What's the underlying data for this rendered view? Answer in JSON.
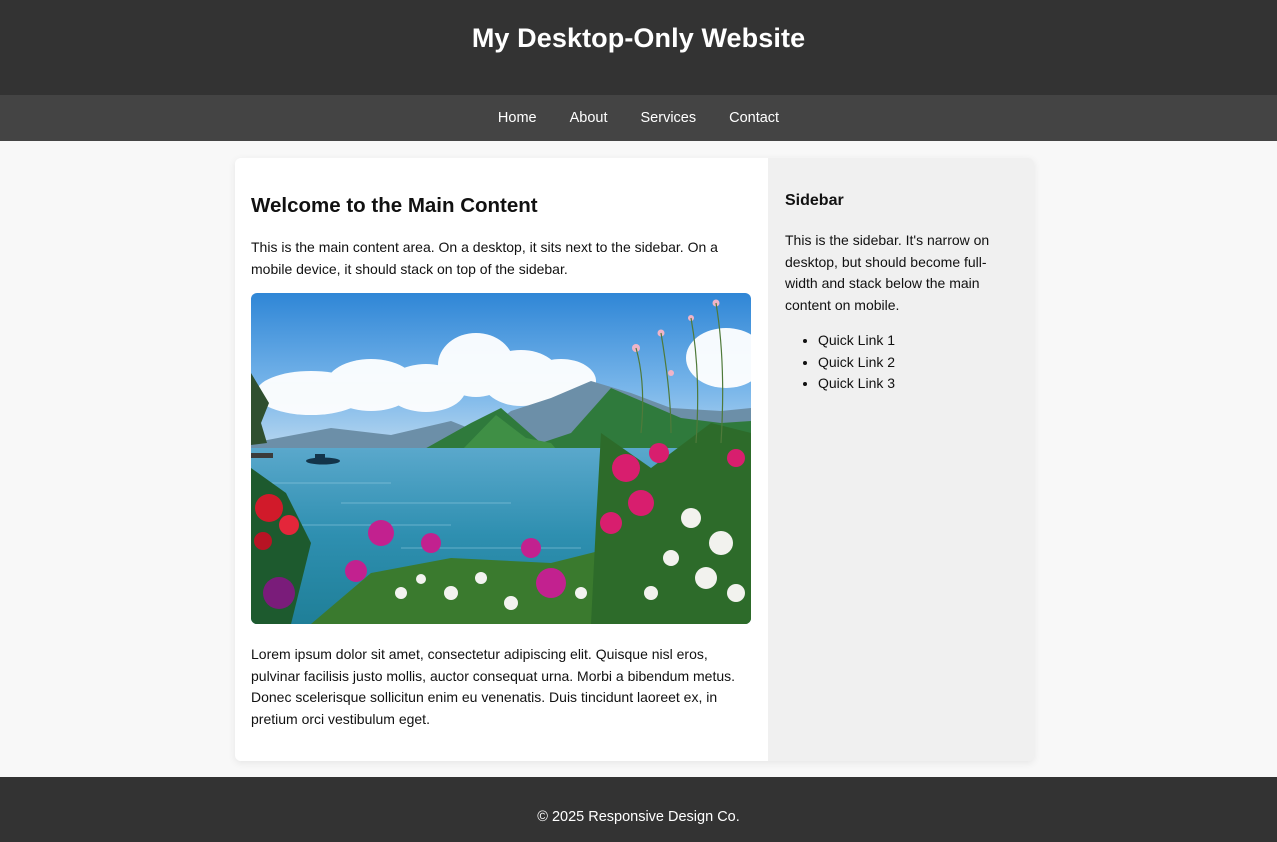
{
  "header": {
    "title": "My Desktop-Only Website"
  },
  "nav": {
    "items": [
      {
        "label": "Home"
      },
      {
        "label": "About"
      },
      {
        "label": "Services"
      },
      {
        "label": "Contact"
      }
    ]
  },
  "main": {
    "heading": "Welcome to the Main Content",
    "intro": "This is the main content area. On a desktop, it sits next to the sidebar. On a mobile device, it should stack on top of the sidebar.",
    "image": {
      "subject": "lake-with-mountains-and-flowers"
    },
    "body": "Lorem ipsum dolor sit amet, consectetur adipiscing elit. Quisque nisl eros, pulvinar facilisis justo mollis, auctor consequat urna. Morbi a bibendum metus. Donec scelerisque sollicitun enim eu venenatis. Duis tincidunt laoreet ex, in pretium orci vestibulum eget."
  },
  "sidebar": {
    "heading": "Sidebar",
    "text": "This is the sidebar. It's narrow on desktop, but should become full-width and stack below the main content on mobile.",
    "links": [
      {
        "label": "Quick Link 1"
      },
      {
        "label": "Quick Link 2"
      },
      {
        "label": "Quick Link 3"
      }
    ]
  },
  "footer": {
    "text": "© 2025 Responsive Design Co."
  },
  "colors": {
    "header_bg": "#333333",
    "nav_bg": "#444444",
    "page_bg": "#f8f8f8",
    "sidebar_bg": "#f0f0f0"
  }
}
